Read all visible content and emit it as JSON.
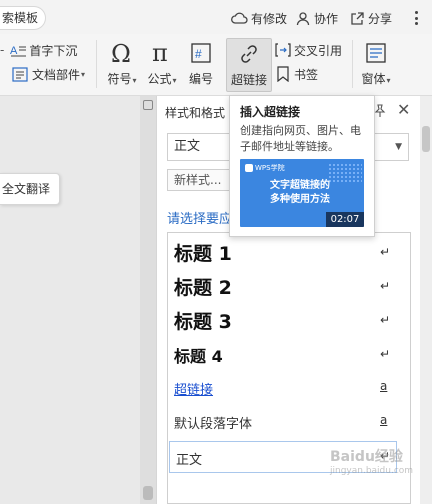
{
  "topbar": {
    "template_tab": "索模板",
    "actions": {
      "revision": "有修改",
      "collaborate": "协作",
      "share": "分享"
    }
  },
  "ribbon": {
    "first_indent": "首字下沉",
    "doc_parts": "文档部件",
    "symbol": "符号",
    "formula": "公式",
    "numbering": "编号",
    "hyperlink": "超链接",
    "cross_ref": "交叉引用",
    "bookmark": "书签",
    "form": "窗体"
  },
  "document": {
    "translate_chip": "全文翻译"
  },
  "styles_panel": {
    "title": "样式和格式",
    "current_style": "正文",
    "new_style": "新样式...",
    "apply_label": "请选择要应",
    "styles": [
      {
        "name": "标题  1",
        "mark": "↵"
      },
      {
        "name": "标题  2",
        "mark": "↵"
      },
      {
        "name": "标题  3",
        "mark": "↵"
      },
      {
        "name": "标题  4",
        "mark": "↵"
      },
      {
        "name": "超链接",
        "mark": "a"
      },
      {
        "name": "默认段落字体",
        "mark": "a"
      },
      {
        "name": "正文",
        "mark": "↵"
      }
    ]
  },
  "tooltip": {
    "title": "插入超链接",
    "description": "创建指向网页、图片、电子邮件地址等链接。",
    "video": {
      "brand": "WPS学院",
      "title_line1": "文字超链接的",
      "title_line2": "多种使用方法",
      "duration": "02:07"
    }
  },
  "watermark": {
    "text": "Baidu经验",
    "sub": "jingyan.baidu.com"
  },
  "colors": {
    "accent_blue": "#2b6cc4",
    "video_bg": "#3b86e0"
  }
}
